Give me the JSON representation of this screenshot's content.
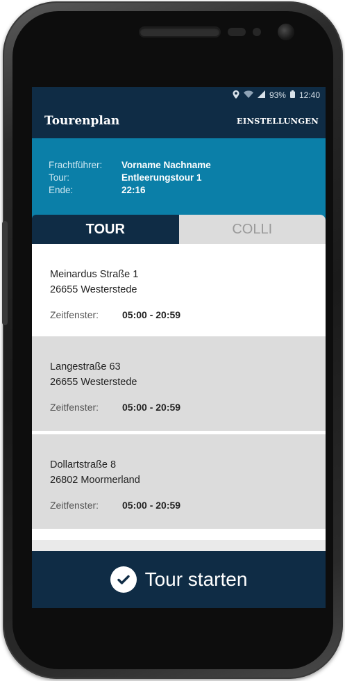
{
  "status_bar": {
    "battery": "93%",
    "time": "12:40"
  },
  "app_bar": {
    "title": "Tourenplan",
    "settings_label": "EINSTELLUNGEN"
  },
  "info": {
    "carrier_label": "Frachtführer:",
    "carrier_value": "Vorname Nachname",
    "tour_label": "Tour:",
    "tour_value": "Entleerungstour 1",
    "end_label": "Ende:",
    "end_value": "22:16"
  },
  "tabs": [
    {
      "label": "TOUR",
      "active": true
    },
    {
      "label": "COLLI",
      "active": false
    }
  ],
  "stops": [
    {
      "street": "Meinardus Straße 1",
      "city": "26655 Westerstede",
      "window_label": "Zeitfenster:",
      "window_value": "05:00 - 20:59"
    },
    {
      "street": "Langestraße 63",
      "city": "26655 Westerstede",
      "window_label": "Zeitfenster:",
      "window_value": "05:00 - 20:59"
    },
    {
      "street": "Dollartstraße 8",
      "city": "26802 Moormerland",
      "window_label": "Zeitfenster:",
      "window_value": "05:00 - 20:59"
    }
  ],
  "start_button": {
    "label": "Tour starten"
  },
  "colors": {
    "primary_dark": "#0f2c45",
    "accent_teal": "#0b7fa8",
    "row_grey": "#dcdcdc"
  }
}
